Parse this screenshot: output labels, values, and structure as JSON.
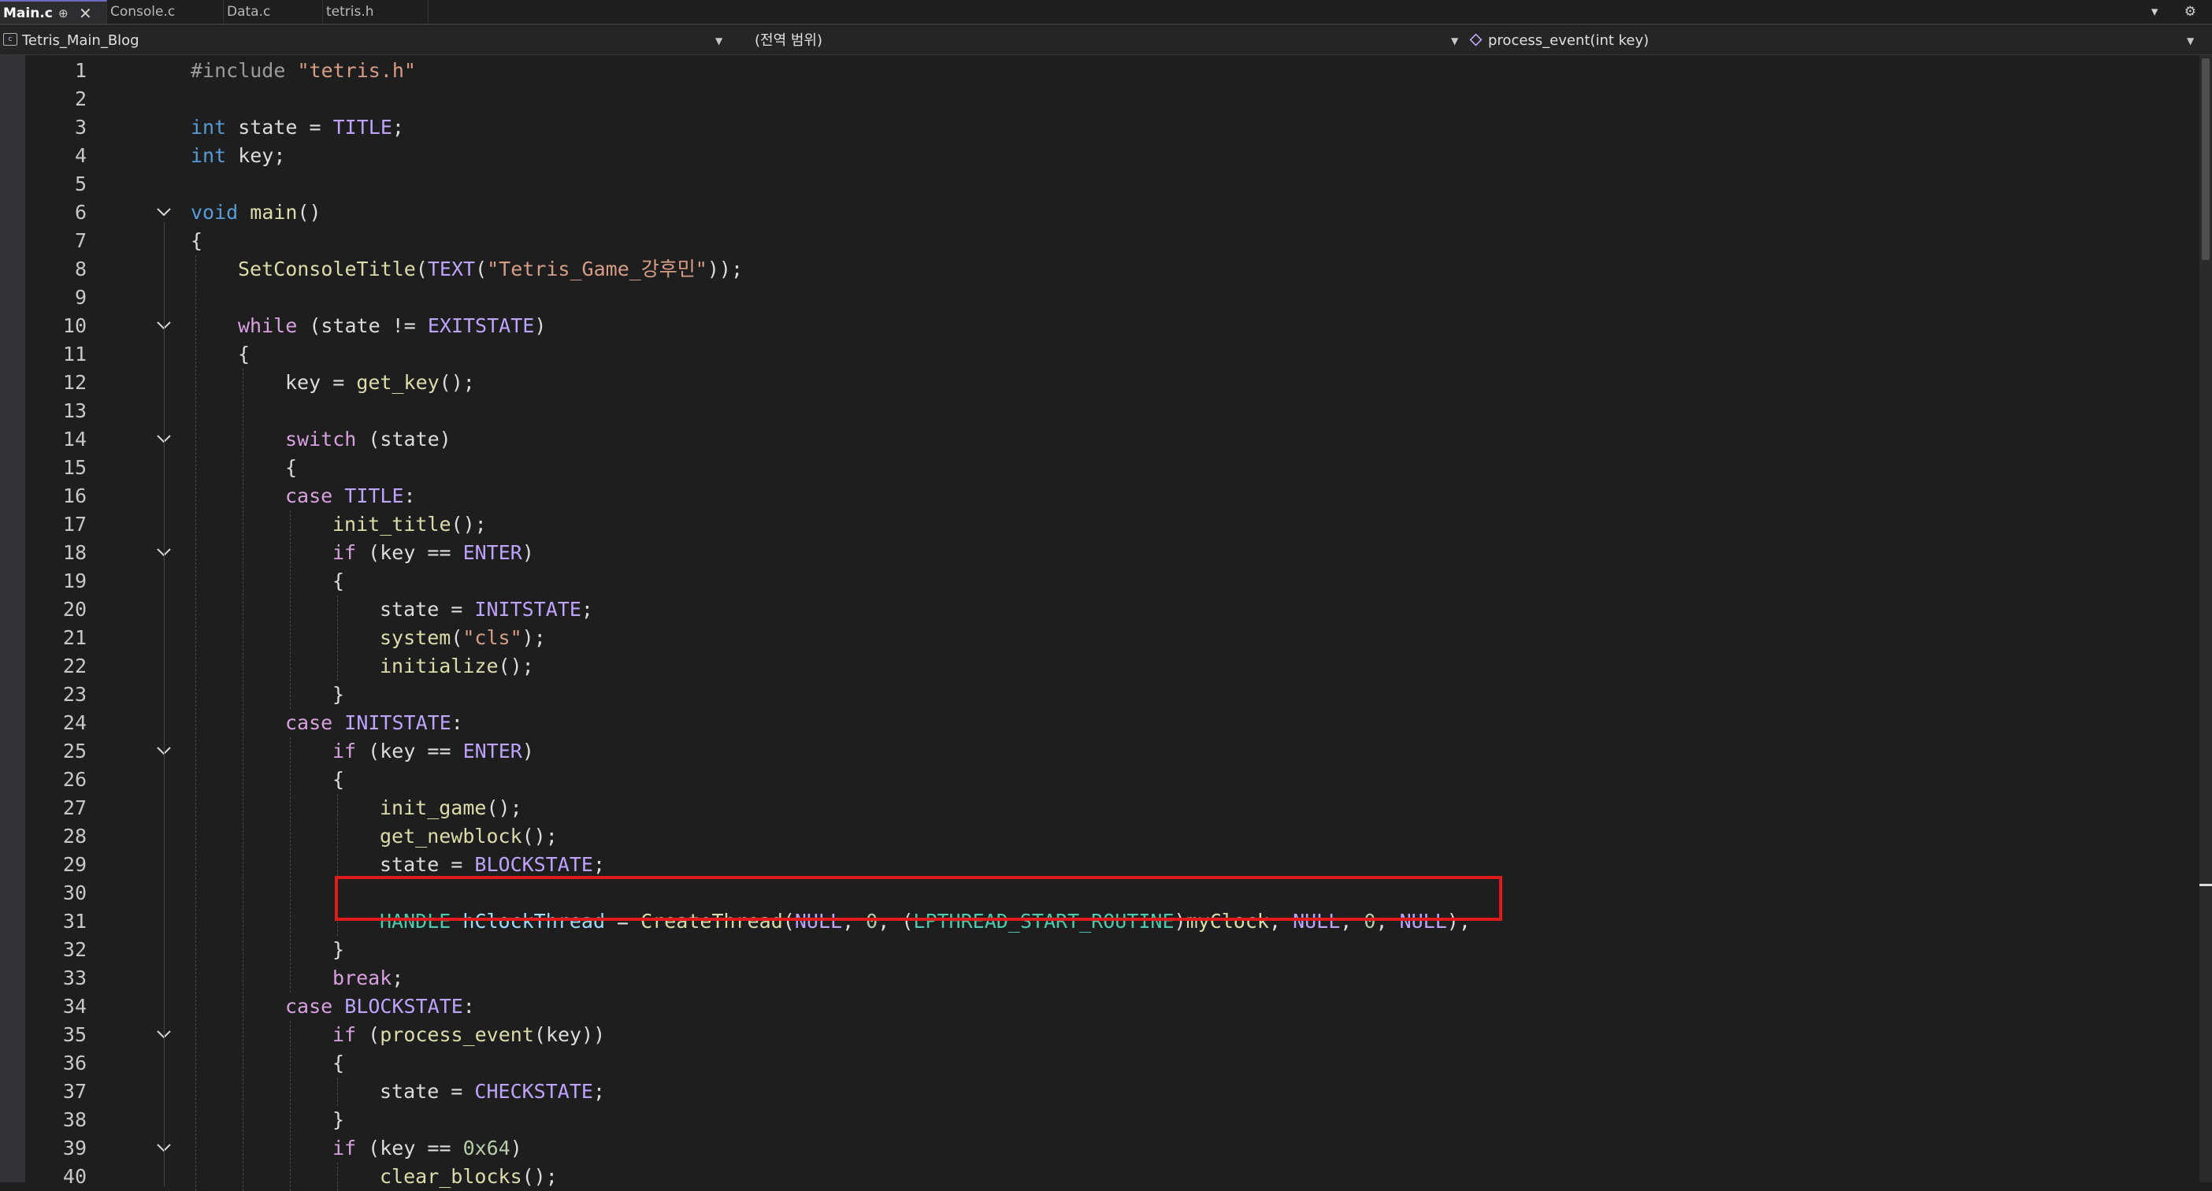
{
  "tabs": [
    {
      "label": "Main.c",
      "active": true
    },
    {
      "label": "Console.c",
      "active": false
    },
    {
      "label": "Data.c",
      "active": false
    },
    {
      "label": "tetris.h",
      "active": false
    }
  ],
  "tab_controls": {
    "pin": "⊕",
    "close": "✕",
    "right_glyphs": "▾ ⚙"
  },
  "nav": {
    "project": "Tetris_Main_Blog",
    "scope": "(전역 범위)",
    "member": "process_event(int key)"
  },
  "colors": {
    "highlight_border": "#e01b1b",
    "keyword": "#569cd6",
    "control": "#d8a0df",
    "function": "#dcdcaa",
    "macro": "#bea3ff",
    "string": "#d69d85",
    "type": "#4ec9b0",
    "number": "#b5cea8"
  },
  "code_lines": [
    {
      "n": "1",
      "indent": 0,
      "fold": false,
      "tokens": [
        [
          "pp",
          "#include "
        ],
        [
          "str",
          "\"tetris.h\""
        ]
      ]
    },
    {
      "n": "2",
      "indent": 0,
      "fold": false,
      "tokens": []
    },
    {
      "n": "3",
      "indent": 0,
      "fold": false,
      "tokens": [
        [
          "kw",
          "int"
        ],
        [
          "plain",
          " state = "
        ],
        [
          "mac",
          "TITLE"
        ],
        [
          "plain",
          ";"
        ]
      ]
    },
    {
      "n": "4",
      "indent": 0,
      "fold": false,
      "tokens": [
        [
          "kw",
          "int"
        ],
        [
          "plain",
          " key;"
        ]
      ]
    },
    {
      "n": "5",
      "indent": 0,
      "fold": false,
      "tokens": []
    },
    {
      "n": "6",
      "indent": 0,
      "fold": true,
      "tokens": [
        [
          "kw",
          "void"
        ],
        [
          "plain",
          " "
        ],
        [
          "fn",
          "main"
        ],
        [
          "plain",
          "()"
        ]
      ]
    },
    {
      "n": "7",
      "indent": 0,
      "fold": false,
      "tokens": [
        [
          "plain",
          "{"
        ]
      ]
    },
    {
      "n": "8",
      "indent": 1,
      "fold": false,
      "tokens": [
        [
          "fn",
          "SetConsoleTitle"
        ],
        [
          "plain",
          "("
        ],
        [
          "mac",
          "TEXT"
        ],
        [
          "plain",
          "("
        ],
        [
          "str",
          "\"Tetris_Game_강후민\""
        ],
        [
          "plain",
          "));"
        ]
      ]
    },
    {
      "n": "9",
      "indent": 0,
      "fold": false,
      "tokens": []
    },
    {
      "n": "10",
      "indent": 1,
      "fold": true,
      "tokens": [
        [
          "ctl",
          "while"
        ],
        [
          "plain",
          " (state != "
        ],
        [
          "mac",
          "EXITSTATE"
        ],
        [
          "plain",
          ")"
        ]
      ]
    },
    {
      "n": "11",
      "indent": 1,
      "fold": false,
      "tokens": [
        [
          "plain",
          "{"
        ]
      ]
    },
    {
      "n": "12",
      "indent": 2,
      "fold": false,
      "tokens": [
        [
          "plain",
          "key = "
        ],
        [
          "fn",
          "get_key"
        ],
        [
          "plain",
          "();"
        ]
      ]
    },
    {
      "n": "13",
      "indent": 0,
      "fold": false,
      "tokens": []
    },
    {
      "n": "14",
      "indent": 2,
      "fold": true,
      "tokens": [
        [
          "ctl",
          "switch"
        ],
        [
          "plain",
          " (state)"
        ]
      ]
    },
    {
      "n": "15",
      "indent": 2,
      "fold": false,
      "tokens": [
        [
          "plain",
          "{"
        ]
      ]
    },
    {
      "n": "16",
      "indent": 2,
      "fold": false,
      "tokens": [
        [
          "ctl",
          "case"
        ],
        [
          "plain",
          " "
        ],
        [
          "mac",
          "TITLE"
        ],
        [
          "plain",
          ":"
        ]
      ]
    },
    {
      "n": "17",
      "indent": 3,
      "fold": false,
      "tokens": [
        [
          "fn",
          "init_title"
        ],
        [
          "plain",
          "();"
        ]
      ]
    },
    {
      "n": "18",
      "indent": 3,
      "fold": true,
      "tokens": [
        [
          "ctl",
          "if"
        ],
        [
          "plain",
          " (key == "
        ],
        [
          "mac",
          "ENTER"
        ],
        [
          "plain",
          ")"
        ]
      ]
    },
    {
      "n": "19",
      "indent": 3,
      "fold": false,
      "tokens": [
        [
          "plain",
          "{"
        ]
      ]
    },
    {
      "n": "20",
      "indent": 4,
      "fold": false,
      "tokens": [
        [
          "plain",
          "state = "
        ],
        [
          "mac",
          "INITSTATE"
        ],
        [
          "plain",
          ";"
        ]
      ]
    },
    {
      "n": "21",
      "indent": 4,
      "fold": false,
      "tokens": [
        [
          "fn",
          "system"
        ],
        [
          "plain",
          "("
        ],
        [
          "str",
          "\"cls\""
        ],
        [
          "plain",
          ");"
        ]
      ]
    },
    {
      "n": "22",
      "indent": 4,
      "fold": false,
      "tokens": [
        [
          "fn",
          "initialize"
        ],
        [
          "plain",
          "();"
        ]
      ]
    },
    {
      "n": "23",
      "indent": 3,
      "fold": false,
      "tokens": [
        [
          "plain",
          "}"
        ]
      ]
    },
    {
      "n": "24",
      "indent": 2,
      "fold": false,
      "tokens": [
        [
          "ctl",
          "case"
        ],
        [
          "plain",
          " "
        ],
        [
          "mac",
          "INITSTATE"
        ],
        [
          "plain",
          ":"
        ]
      ]
    },
    {
      "n": "25",
      "indent": 3,
      "fold": true,
      "tokens": [
        [
          "ctl",
          "if"
        ],
        [
          "plain",
          " (key == "
        ],
        [
          "mac",
          "ENTER"
        ],
        [
          "plain",
          ")"
        ]
      ]
    },
    {
      "n": "26",
      "indent": 3,
      "fold": false,
      "tokens": [
        [
          "plain",
          "{"
        ]
      ]
    },
    {
      "n": "27",
      "indent": 4,
      "fold": false,
      "tokens": [
        [
          "fn",
          "init_game"
        ],
        [
          "plain",
          "();"
        ]
      ]
    },
    {
      "n": "28",
      "indent": 4,
      "fold": false,
      "tokens": [
        [
          "fn",
          "get_newblock"
        ],
        [
          "plain",
          "();"
        ]
      ]
    },
    {
      "n": "29",
      "indent": 4,
      "fold": false,
      "tokens": [
        [
          "plain",
          "state = "
        ],
        [
          "mac",
          "BLOCKSTATE"
        ],
        [
          "plain",
          ";"
        ]
      ]
    },
    {
      "n": "30",
      "indent": 0,
      "fold": false,
      "tokens": []
    },
    {
      "n": "31",
      "indent": 4,
      "fold": false,
      "tokens": [
        [
          "type",
          "HANDLE"
        ],
        [
          "plain",
          " "
        ],
        [
          "var",
          "hClockThread"
        ],
        [
          "plain",
          " = "
        ],
        [
          "fn",
          "CreateThread"
        ],
        [
          "plain",
          "("
        ],
        [
          "mac",
          "NULL"
        ],
        [
          "plain",
          ", "
        ],
        [
          "num",
          "0"
        ],
        [
          "plain",
          ", ("
        ],
        [
          "type",
          "LPTHREAD_START_ROUTINE"
        ],
        [
          "plain",
          ")"
        ],
        [
          "fn",
          "myClock"
        ],
        [
          "plain",
          ", "
        ],
        [
          "mac",
          "NULL"
        ],
        [
          "plain",
          ", "
        ],
        [
          "num",
          "0"
        ],
        [
          "plain",
          ", "
        ],
        [
          "mac",
          "NULL"
        ],
        [
          "plain",
          ");"
        ]
      ]
    },
    {
      "n": "32",
      "indent": 3,
      "fold": false,
      "tokens": [
        [
          "plain",
          "}"
        ]
      ]
    },
    {
      "n": "33",
      "indent": 3,
      "fold": false,
      "tokens": [
        [
          "ctl",
          "break"
        ],
        [
          "plain",
          ";"
        ]
      ]
    },
    {
      "n": "34",
      "indent": 2,
      "fold": false,
      "tokens": [
        [
          "ctl",
          "case"
        ],
        [
          "plain",
          " "
        ],
        [
          "mac",
          "BLOCKSTATE"
        ],
        [
          "plain",
          ":"
        ]
      ]
    },
    {
      "n": "35",
      "indent": 3,
      "fold": true,
      "tokens": [
        [
          "ctl",
          "if"
        ],
        [
          "plain",
          " ("
        ],
        [
          "fn",
          "process_event"
        ],
        [
          "plain",
          "(key))"
        ]
      ]
    },
    {
      "n": "36",
      "indent": 3,
      "fold": false,
      "tokens": [
        [
          "plain",
          "{"
        ]
      ]
    },
    {
      "n": "37",
      "indent": 4,
      "fold": false,
      "tokens": [
        [
          "plain",
          "state = "
        ],
        [
          "mac",
          "CHECKSTATE"
        ],
        [
          "plain",
          ";"
        ]
      ]
    },
    {
      "n": "38",
      "indent": 3,
      "fold": false,
      "tokens": [
        [
          "plain",
          "}"
        ]
      ]
    },
    {
      "n": "39",
      "indent": 3,
      "fold": true,
      "tokens": [
        [
          "ctl",
          "if"
        ],
        [
          "plain",
          " (key == "
        ],
        [
          "num",
          "0x64"
        ],
        [
          "plain",
          ")"
        ]
      ]
    },
    {
      "n": "40",
      "indent": 4,
      "fold": false,
      "tokens": [
        [
          "fn",
          "clear_blocks"
        ],
        [
          "plain",
          "();"
        ]
      ]
    }
  ]
}
